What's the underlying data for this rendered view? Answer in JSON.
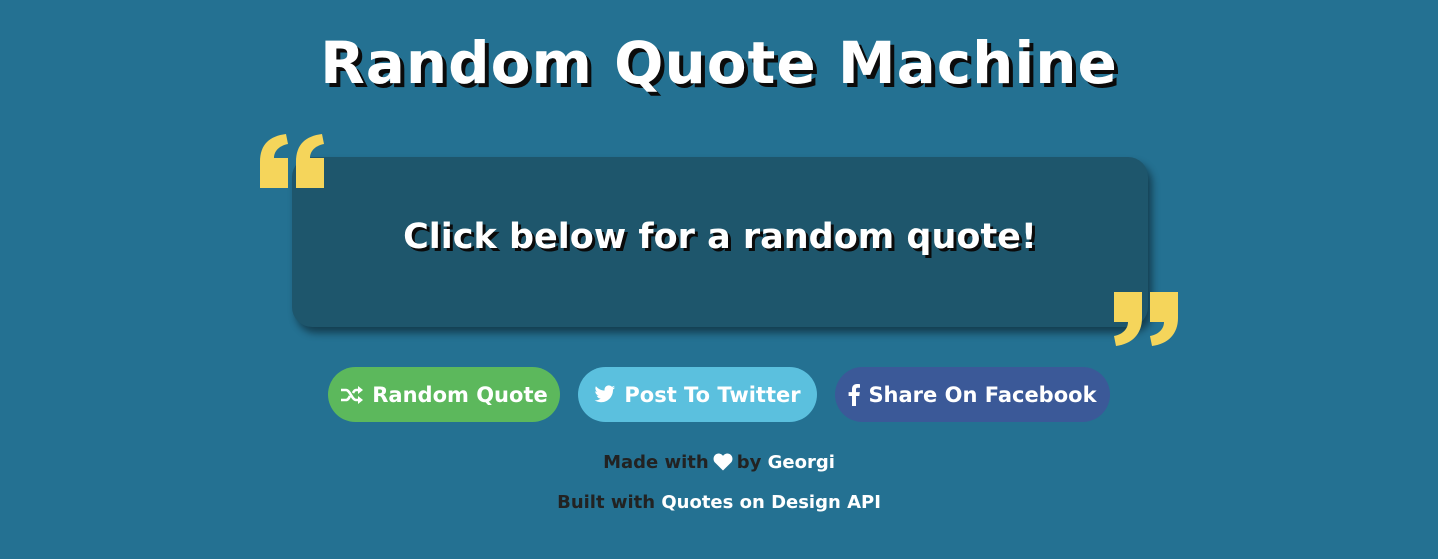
{
  "header": {
    "title": "Random Quote Machine"
  },
  "quote": {
    "text": "Click below for a random quote!"
  },
  "buttons": {
    "random_label": "Random Quote",
    "twitter_label": "Post To Twitter",
    "facebook_label": "Share On Facebook"
  },
  "footer": {
    "made_with": "Made with",
    "by": "by",
    "author": "Georgi",
    "built_with": "Built with",
    "api_link": "Quotes on Design API"
  },
  "icons": {
    "open_quote": "open-quote-icon",
    "close_quote": "close-quote-icon",
    "shuffle": "shuffle-icon",
    "twitter": "twitter-icon",
    "facebook": "facebook-icon",
    "heart": "heart-icon"
  },
  "colors": {
    "background": "#247192",
    "quote_box": "#1e566c",
    "quote_mark": "#f5d55b",
    "random_button": "#5cb85c",
    "twitter_button": "#5bc0de",
    "facebook_button": "#3b5998"
  }
}
